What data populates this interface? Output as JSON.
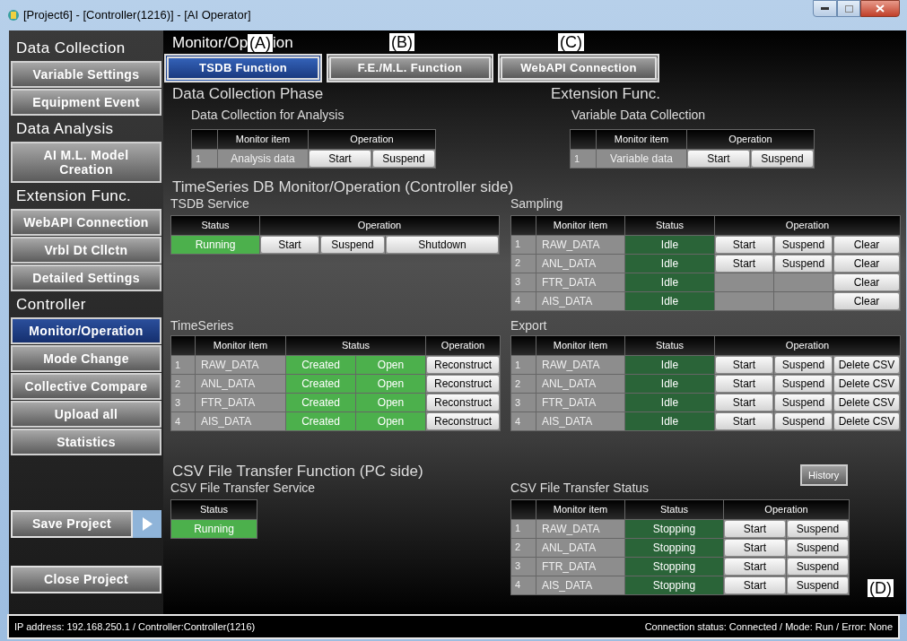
{
  "window": {
    "title": "[Project6] - [Controller(1216)] - [AI Operator]"
  },
  "sidebar": {
    "items": [
      {
        "kind": "heading",
        "label": "Data Collection"
      },
      {
        "kind": "button",
        "label": "Variable Settings",
        "selected": false
      },
      {
        "kind": "button",
        "label": "Equipment Event",
        "selected": false
      },
      {
        "kind": "heading",
        "label": "Data Analysis"
      },
      {
        "kind": "button",
        "label": "AI M.L. Model\nCreation",
        "selected": false
      },
      {
        "kind": "heading",
        "label": "Extension Func."
      },
      {
        "kind": "button",
        "label": "WebAPI Connection",
        "selected": false
      },
      {
        "kind": "button",
        "label": "Vrbl Dt Cllctn",
        "selected": false
      },
      {
        "kind": "button",
        "label": "Detailed Settings",
        "selected": false
      },
      {
        "kind": "heading",
        "label": "Controller"
      },
      {
        "kind": "button",
        "label": "Monitor/Operation",
        "selected": true
      },
      {
        "kind": "button",
        "label": "Mode Change",
        "selected": false
      },
      {
        "kind": "button",
        "label": "Collective Compare",
        "selected": false
      },
      {
        "kind": "button",
        "label": "Upload all",
        "selected": false
      },
      {
        "kind": "button",
        "label": "Statistics",
        "selected": false
      }
    ],
    "project_buttons": [
      {
        "kind": "save",
        "label": "Save Project"
      },
      {
        "kind": "close",
        "label": "Close Project"
      }
    ]
  },
  "main": {
    "title_parts": [
      "Monitor/Op",
      "ion"
    ],
    "callouts": [
      "(A)",
      "(B)",
      "(C)",
      "(D)"
    ],
    "tabs": [
      {
        "label": "TSDB Function",
        "selected": true
      },
      {
        "label": "F.E./M.L. Function",
        "selected": false
      },
      {
        "label": "WebAPI Connection",
        "selected": false
      }
    ],
    "data_collection_phase": {
      "title": "Data Collection Phase",
      "subtitle": "Data Collection for Analysis",
      "table": {
        "header": [
          "Monitor item",
          "Operation"
        ],
        "rows": [
          {
            "cells": [
              {
                "kind": "index",
                "text": "1"
              },
              {
                "kind": "item",
                "text": "Analysis data"
              },
              {
                "kind": "button",
                "text": "Start"
              },
              {
                "kind": "button",
                "text": "Suspend"
              }
            ]
          }
        ]
      }
    },
    "extension_func": {
      "title": "Extension Func.",
      "subtitle": "Variable Data Collection",
      "table": {
        "header": [
          "Monitor item",
          "Operation"
        ],
        "rows": [
          {
            "cells": [
              {
                "kind": "index",
                "text": "1"
              },
              {
                "kind": "item",
                "text": "Variable data"
              },
              {
                "kind": "button",
                "text": "Start"
              },
              {
                "kind": "button",
                "text": "Suspend"
              }
            ]
          }
        ]
      }
    },
    "tsdb_monitor": {
      "title": "TimeSeries DB Monitor/Operation (Controller side)",
      "tsdb_service": {
        "title": "TSDB Service",
        "table": {
          "header": [
            "Status",
            "Operation"
          ],
          "rows": [
            {
              "cells": [
                {
                  "kind": "status",
                  "text": "Running",
                  "color": "#4cb04c"
                },
                {
                  "kind": "button",
                  "text": "Start"
                },
                {
                  "kind": "button",
                  "text": "Suspend"
                },
                {
                  "kind": "button",
                  "text": "Shutdown"
                }
              ]
            }
          ]
        }
      },
      "timeseries": {
        "title": "TimeSeries",
        "table": {
          "header": [
            "Monitor item",
            "Status",
            "Operation"
          ],
          "rows": [
            {
              "cells": [
                {
                  "kind": "index",
                  "text": "1"
                },
                {
                  "kind": "item",
                  "text": "RAW_DATA"
                },
                {
                  "kind": "status",
                  "text": "Created",
                  "color": "#4cb04c"
                },
                {
                  "kind": "status",
                  "text": "Open",
                  "color": "#4cb04c"
                },
                {
                  "kind": "button",
                  "text": "Reconstruct"
                }
              ]
            },
            {
              "cells": [
                {
                  "kind": "index",
                  "text": "2"
                },
                {
                  "kind": "item",
                  "text": "ANL_DATA"
                },
                {
                  "kind": "status",
                  "text": "Created",
                  "color": "#4cb04c"
                },
                {
                  "kind": "status",
                  "text": "Open",
                  "color": "#4cb04c"
                },
                {
                  "kind": "button",
                  "text": "Reconstruct"
                }
              ]
            },
            {
              "cells": [
                {
                  "kind": "index",
                  "text": "3"
                },
                {
                  "kind": "item",
                  "text": "FTR_DATA"
                },
                {
                  "kind": "status",
                  "text": "Created",
                  "color": "#4cb04c"
                },
                {
                  "kind": "status",
                  "text": "Open",
                  "color": "#4cb04c"
                },
                {
                  "kind": "button",
                  "text": "Reconstruct"
                }
              ]
            },
            {
              "cells": [
                {
                  "kind": "index",
                  "text": "4"
                },
                {
                  "kind": "item",
                  "text": "AIS_DATA"
                },
                {
                  "kind": "status",
                  "text": "Created",
                  "color": "#4cb04c"
                },
                {
                  "kind": "status",
                  "text": "Open",
                  "color": "#4cb04c"
                },
                {
                  "kind": "button",
                  "text": "Reconstruct"
                }
              ]
            }
          ]
        }
      },
      "sampling": {
        "title": "Sampling",
        "table": {
          "header": [
            "Monitor item",
            "Status",
            "Operation"
          ],
          "rows": [
            {
              "cells": [
                {
                  "kind": "index",
                  "text": "1"
                },
                {
                  "kind": "item",
                  "text": "RAW_DATA"
                },
                {
                  "kind": "status",
                  "text": "Idle",
                  "color": "#2a6438"
                },
                {
                  "kind": "button",
                  "text": "Start"
                },
                {
                  "kind": "button",
                  "text": "Suspend"
                },
                {
                  "kind": "button",
                  "text": "Clear"
                }
              ]
            },
            {
              "cells": [
                {
                  "kind": "index",
                  "text": "2"
                },
                {
                  "kind": "item",
                  "text": "ANL_DATA"
                },
                {
                  "kind": "status",
                  "text": "Idle",
                  "color": "#2a6438"
                },
                {
                  "kind": "button",
                  "text": "Start"
                },
                {
                  "kind": "button",
                  "text": "Suspend"
                },
                {
                  "kind": "button",
                  "text": "Clear"
                }
              ]
            },
            {
              "cells": [
                {
                  "kind": "index",
                  "text": "3"
                },
                {
                  "kind": "item",
                  "text": "FTR_DATA"
                },
                {
                  "kind": "status",
                  "text": "Idle",
                  "color": "#2a6438"
                },
                {
                  "kind": "empty"
                },
                {
                  "kind": "empty"
                },
                {
                  "kind": "button",
                  "text": "Clear"
                }
              ]
            },
            {
              "cells": [
                {
                  "kind": "index",
                  "text": "4"
                },
                {
                  "kind": "item",
                  "text": "AIS_DATA"
                },
                {
                  "kind": "status",
                  "text": "Idle",
                  "color": "#2a6438"
                },
                {
                  "kind": "empty"
                },
                {
                  "kind": "empty"
                },
                {
                  "kind": "button",
                  "text": "Clear"
                }
              ]
            }
          ]
        }
      },
      "export": {
        "title": "Export",
        "table": {
          "header": [
            "Monitor item",
            "Status",
            "Operation"
          ],
          "rows": [
            {
              "cells": [
                {
                  "kind": "index",
                  "text": "1"
                },
                {
                  "kind": "item",
                  "text": "RAW_DATA"
                },
                {
                  "kind": "status",
                  "text": "Idle",
                  "color": "#2a6438"
                },
                {
                  "kind": "button",
                  "text": "Start"
                },
                {
                  "kind": "button",
                  "text": "Suspend"
                },
                {
                  "kind": "button",
                  "text": "Delete CSV"
                }
              ]
            },
            {
              "cells": [
                {
                  "kind": "index",
                  "text": "2"
                },
                {
                  "kind": "item",
                  "text": "ANL_DATA"
                },
                {
                  "kind": "status",
                  "text": "Idle",
                  "color": "#2a6438"
                },
                {
                  "kind": "button",
                  "text": "Start"
                },
                {
                  "kind": "button",
                  "text": "Suspend"
                },
                {
                  "kind": "button",
                  "text": "Delete CSV"
                }
              ]
            },
            {
              "cells": [
                {
                  "kind": "index",
                  "text": "3"
                },
                {
                  "kind": "item",
                  "text": "FTR_DATA"
                },
                {
                  "kind": "status",
                  "text": "Idle",
                  "color": "#2a6438"
                },
                {
                  "kind": "button",
                  "text": "Start"
                },
                {
                  "kind": "button",
                  "text": "Suspend"
                },
                {
                  "kind": "button",
                  "text": "Delete CSV"
                }
              ]
            },
            {
              "cells": [
                {
                  "kind": "index",
                  "text": "4"
                },
                {
                  "kind": "item",
                  "text": "AIS_DATA"
                },
                {
                  "kind": "status",
                  "text": "Idle",
                  "color": "#2a6438"
                },
                {
                  "kind": "button",
                  "text": "Start"
                },
                {
                  "kind": "button",
                  "text": "Suspend"
                },
                {
                  "kind": "button",
                  "text": "Delete CSV"
                }
              ]
            }
          ]
        }
      }
    },
    "csv_transfer": {
      "title": "CSV File Transfer Function (PC side)",
      "history_button": "History",
      "service": {
        "title": "CSV File Transfer Service",
        "table": {
          "header": [
            "Status"
          ],
          "rows": [
            {
              "cells": [
                {
                  "kind": "status",
                  "text": "Running",
                  "color": "#4cb04c"
                }
              ]
            }
          ]
        }
      },
      "status": {
        "title": "CSV File Transfer Status",
        "table": {
          "header": [
            "Monitor item",
            "Status",
            "Operation"
          ],
          "rows": [
            {
              "cells": [
                {
                  "kind": "index",
                  "text": "1"
                },
                {
                  "kind": "item",
                  "text": "RAW_DATA"
                },
                {
                  "kind": "status",
                  "text": "Stopping",
                  "color": "#2a6438"
                },
                {
                  "kind": "button",
                  "text": "Start"
                },
                {
                  "kind": "button",
                  "text": "Suspend"
                }
              ]
            },
            {
              "cells": [
                {
                  "kind": "index",
                  "text": "2"
                },
                {
                  "kind": "item",
                  "text": "ANL_DATA"
                },
                {
                  "kind": "status",
                  "text": "Stopping",
                  "color": "#2a6438"
                },
                {
                  "kind": "button",
                  "text": "Start"
                },
                {
                  "kind": "button",
                  "text": "Suspend"
                }
              ]
            },
            {
              "cells": [
                {
                  "kind": "index",
                  "text": "3"
                },
                {
                  "kind": "item",
                  "text": "FTR_DATA"
                },
                {
                  "kind": "status",
                  "text": "Stopping",
                  "color": "#2a6438"
                },
                {
                  "kind": "button",
                  "text": "Start"
                },
                {
                  "kind": "button",
                  "text": "Suspend"
                }
              ]
            },
            {
              "cells": [
                {
                  "kind": "index",
                  "text": "4"
                },
                {
                  "kind": "item",
                  "text": "AIS_DATA"
                },
                {
                  "kind": "status",
                  "text": "Stopping",
                  "color": "#2a6438"
                },
                {
                  "kind": "button",
                  "text": "Start"
                },
                {
                  "kind": "button",
                  "text": "Suspend"
                }
              ]
            }
          ]
        }
      }
    }
  },
  "status_bar": {
    "left": "IP address: 192.168.250.1 / Controller:Controller(1216)",
    "right": "Connection status: Connected / Mode: Run / Error: None"
  }
}
